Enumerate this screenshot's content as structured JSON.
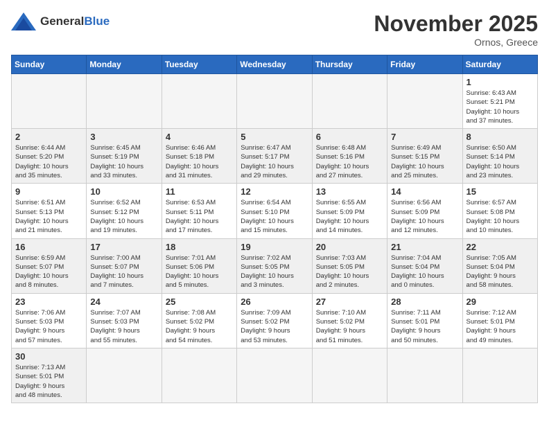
{
  "header": {
    "logo_general": "General",
    "logo_blue": "Blue",
    "month": "November 2025",
    "location": "Ornos, Greece"
  },
  "weekdays": [
    "Sunday",
    "Monday",
    "Tuesday",
    "Wednesday",
    "Thursday",
    "Friday",
    "Saturday"
  ],
  "weeks": [
    [
      {
        "day": "",
        "info": ""
      },
      {
        "day": "",
        "info": ""
      },
      {
        "day": "",
        "info": ""
      },
      {
        "day": "",
        "info": ""
      },
      {
        "day": "",
        "info": ""
      },
      {
        "day": "",
        "info": ""
      },
      {
        "day": "1",
        "info": "Sunrise: 6:43 AM\nSunset: 5:21 PM\nDaylight: 10 hours\nand 37 minutes."
      }
    ],
    [
      {
        "day": "2",
        "info": "Sunrise: 6:44 AM\nSunset: 5:20 PM\nDaylight: 10 hours\nand 35 minutes."
      },
      {
        "day": "3",
        "info": "Sunrise: 6:45 AM\nSunset: 5:19 PM\nDaylight: 10 hours\nand 33 minutes."
      },
      {
        "day": "4",
        "info": "Sunrise: 6:46 AM\nSunset: 5:18 PM\nDaylight: 10 hours\nand 31 minutes."
      },
      {
        "day": "5",
        "info": "Sunrise: 6:47 AM\nSunset: 5:17 PM\nDaylight: 10 hours\nand 29 minutes."
      },
      {
        "day": "6",
        "info": "Sunrise: 6:48 AM\nSunset: 5:16 PM\nDaylight: 10 hours\nand 27 minutes."
      },
      {
        "day": "7",
        "info": "Sunrise: 6:49 AM\nSunset: 5:15 PM\nDaylight: 10 hours\nand 25 minutes."
      },
      {
        "day": "8",
        "info": "Sunrise: 6:50 AM\nSunset: 5:14 PM\nDaylight: 10 hours\nand 23 minutes."
      }
    ],
    [
      {
        "day": "9",
        "info": "Sunrise: 6:51 AM\nSunset: 5:13 PM\nDaylight: 10 hours\nand 21 minutes."
      },
      {
        "day": "10",
        "info": "Sunrise: 6:52 AM\nSunset: 5:12 PM\nDaylight: 10 hours\nand 19 minutes."
      },
      {
        "day": "11",
        "info": "Sunrise: 6:53 AM\nSunset: 5:11 PM\nDaylight: 10 hours\nand 17 minutes."
      },
      {
        "day": "12",
        "info": "Sunrise: 6:54 AM\nSunset: 5:10 PM\nDaylight: 10 hours\nand 15 minutes."
      },
      {
        "day": "13",
        "info": "Sunrise: 6:55 AM\nSunset: 5:09 PM\nDaylight: 10 hours\nand 14 minutes."
      },
      {
        "day": "14",
        "info": "Sunrise: 6:56 AM\nSunset: 5:09 PM\nDaylight: 10 hours\nand 12 minutes."
      },
      {
        "day": "15",
        "info": "Sunrise: 6:57 AM\nSunset: 5:08 PM\nDaylight: 10 hours\nand 10 minutes."
      }
    ],
    [
      {
        "day": "16",
        "info": "Sunrise: 6:59 AM\nSunset: 5:07 PM\nDaylight: 10 hours\nand 8 minutes."
      },
      {
        "day": "17",
        "info": "Sunrise: 7:00 AM\nSunset: 5:07 PM\nDaylight: 10 hours\nand 7 minutes."
      },
      {
        "day": "18",
        "info": "Sunrise: 7:01 AM\nSunset: 5:06 PM\nDaylight: 10 hours\nand 5 minutes."
      },
      {
        "day": "19",
        "info": "Sunrise: 7:02 AM\nSunset: 5:05 PM\nDaylight: 10 hours\nand 3 minutes."
      },
      {
        "day": "20",
        "info": "Sunrise: 7:03 AM\nSunset: 5:05 PM\nDaylight: 10 hours\nand 2 minutes."
      },
      {
        "day": "21",
        "info": "Sunrise: 7:04 AM\nSunset: 5:04 PM\nDaylight: 10 hours\nand 0 minutes."
      },
      {
        "day": "22",
        "info": "Sunrise: 7:05 AM\nSunset: 5:04 PM\nDaylight: 9 hours\nand 58 minutes."
      }
    ],
    [
      {
        "day": "23",
        "info": "Sunrise: 7:06 AM\nSunset: 5:03 PM\nDaylight: 9 hours\nand 57 minutes."
      },
      {
        "day": "24",
        "info": "Sunrise: 7:07 AM\nSunset: 5:03 PM\nDaylight: 9 hours\nand 55 minutes."
      },
      {
        "day": "25",
        "info": "Sunrise: 7:08 AM\nSunset: 5:02 PM\nDaylight: 9 hours\nand 54 minutes."
      },
      {
        "day": "26",
        "info": "Sunrise: 7:09 AM\nSunset: 5:02 PM\nDaylight: 9 hours\nand 53 minutes."
      },
      {
        "day": "27",
        "info": "Sunrise: 7:10 AM\nSunset: 5:02 PM\nDaylight: 9 hours\nand 51 minutes."
      },
      {
        "day": "28",
        "info": "Sunrise: 7:11 AM\nSunset: 5:01 PM\nDaylight: 9 hours\nand 50 minutes."
      },
      {
        "day": "29",
        "info": "Sunrise: 7:12 AM\nSunset: 5:01 PM\nDaylight: 9 hours\nand 49 minutes."
      }
    ],
    [
      {
        "day": "30",
        "info": "Sunrise: 7:13 AM\nSunset: 5:01 PM\nDaylight: 9 hours\nand 48 minutes."
      },
      {
        "day": "",
        "info": ""
      },
      {
        "day": "",
        "info": ""
      },
      {
        "day": "",
        "info": ""
      },
      {
        "day": "",
        "info": ""
      },
      {
        "day": "",
        "info": ""
      },
      {
        "day": "",
        "info": ""
      }
    ]
  ]
}
